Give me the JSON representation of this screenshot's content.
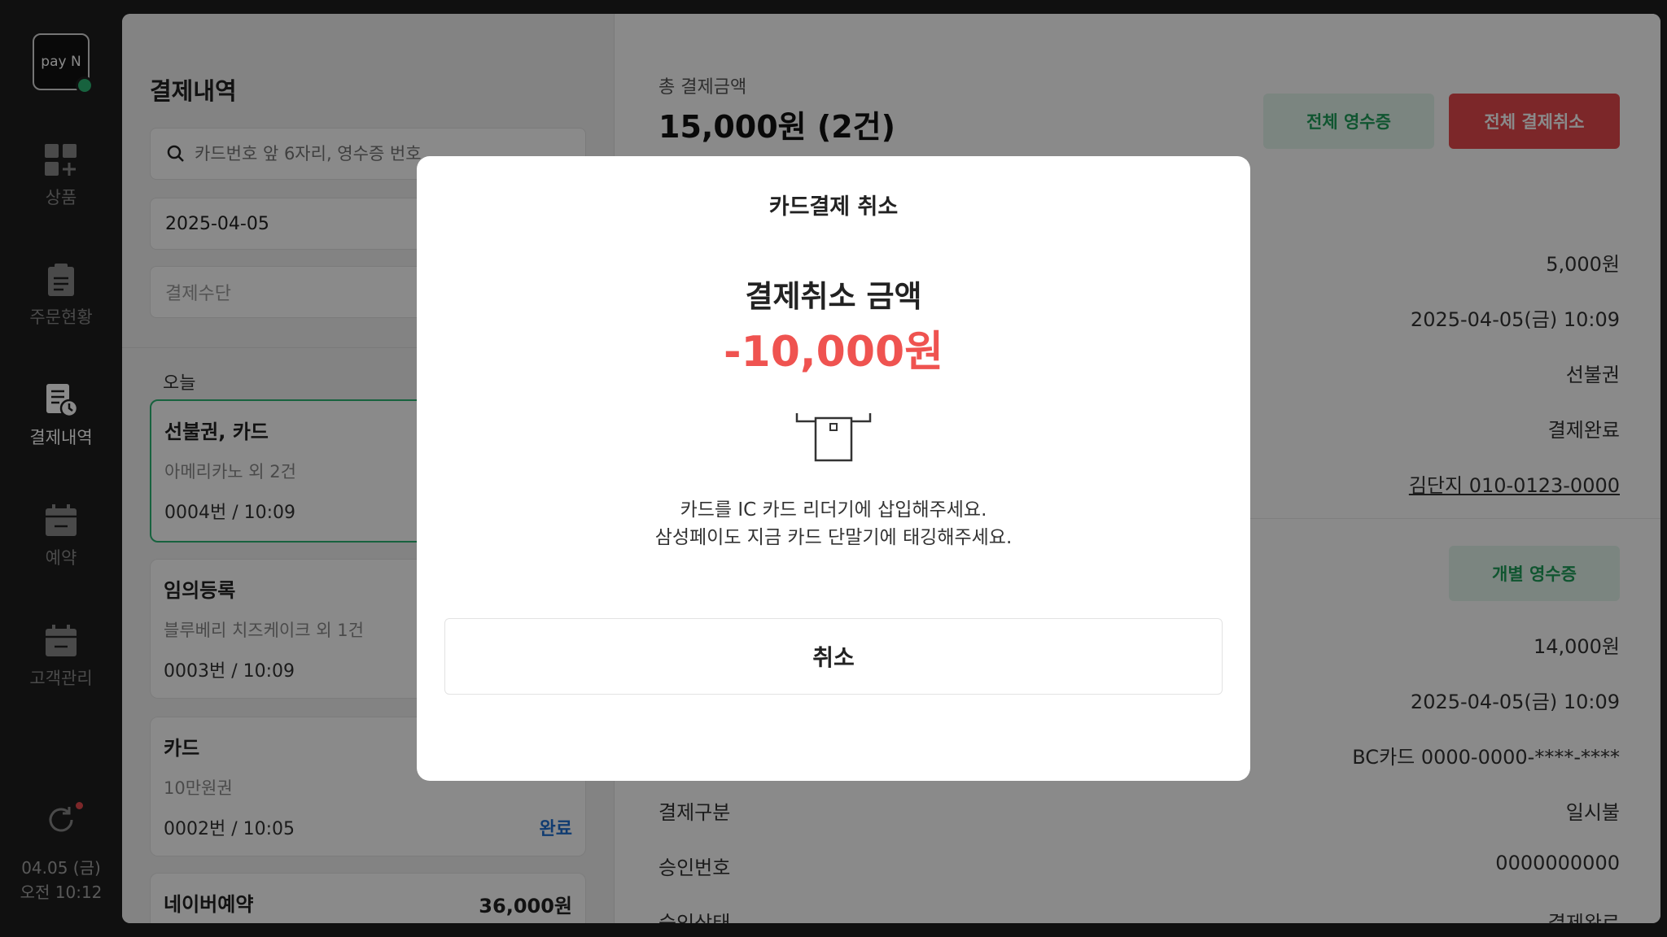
{
  "sidebar": {
    "logo_text": "pay N",
    "items": [
      {
        "label": "상품",
        "icon": "product-grid-icon"
      },
      {
        "label": "주문현황",
        "icon": "clipboard-icon"
      },
      {
        "label": "결제내역",
        "icon": "receipt-clock-icon"
      },
      {
        "label": "예약",
        "icon": "calendar-icon"
      },
      {
        "label": "고객관리",
        "icon": "customer-calendar-icon"
      }
    ],
    "clock_date": "04.05 (금)",
    "clock_time": "오전 10:12"
  },
  "list": {
    "title": "결제내역",
    "search_placeholder": "카드번호 앞 6자리, 영수증 번호",
    "date": "2025-04-05",
    "method_placeholder": "결제수단",
    "group_label": "오늘",
    "cards": [
      {
        "title": "선불권, 카드",
        "sub": "아메리카노 외 2건",
        "meta": "0004번   /   10:09",
        "status": ""
      },
      {
        "title": "임의등록",
        "sub": "블루베리 치즈케이크 외 1건",
        "meta": "0003번   /   10:09",
        "status": ""
      },
      {
        "title": "카드",
        "sub": "10만원권",
        "meta": "0002번   /   10:05",
        "status": "완료"
      },
      {
        "title": "네이버예약",
        "amount": "36,000원"
      }
    ]
  },
  "detail": {
    "total_label": "총 결제금액",
    "total_value": "15,000원 (2건)",
    "btn_receipt_all": "전체 영수증",
    "btn_cancel_all": "전체 결제취소",
    "btn_receipt_each": "개별 영수증",
    "values_top": [
      "5,000원",
      "2025-04-05(금) 10:09",
      "선불권",
      "결제완료",
      "김단지 010-0123-0000"
    ],
    "values_bottom": [
      "14,000원",
      "2025-04-05(금) 10:09",
      "BC카드 0000-0000-****-****"
    ],
    "rows": [
      {
        "label": "결제구분",
        "value": "일시불"
      },
      {
        "label": "승인번호",
        "value": "0000000000"
      },
      {
        "label": "승인상태",
        "value": "결제완료"
      }
    ]
  },
  "modal": {
    "title": "카드결제 취소",
    "amount_label": "결제취소 금액",
    "amount": "-10,000원",
    "icon": "card-reader-icon",
    "msg_line1": "카드를 IC 카드 리더기에 삽입해주세요.",
    "msg_line2": "삼성페이도 지금 카드 단말기에 태깅해주세요.",
    "cancel_label": "취소"
  },
  "colors": {
    "accent_green": "#2bb673",
    "danger_red": "#e5484d",
    "amount_red": "#ef5350"
  }
}
